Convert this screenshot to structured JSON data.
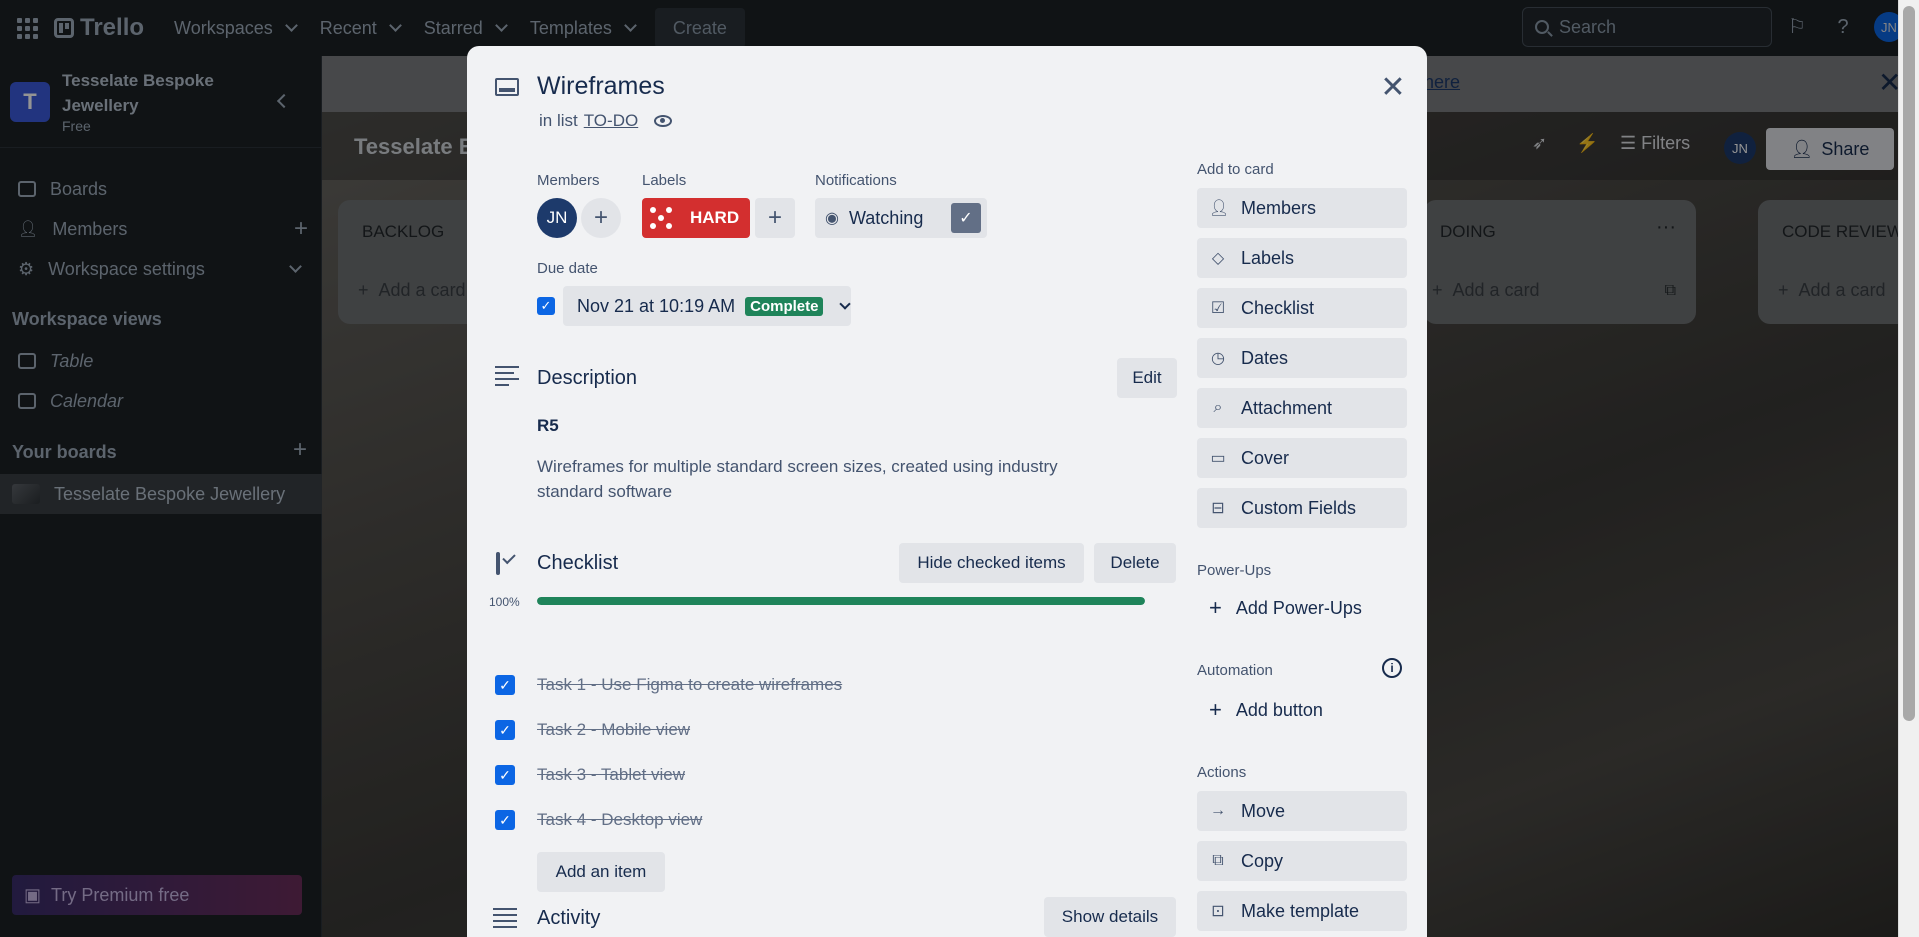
{
  "topbar": {
    "brand": "Trello",
    "nav": [
      "Workspaces",
      "Recent",
      "Starred",
      "Templates"
    ],
    "create_label": "Create",
    "search_placeholder": "Search",
    "avatar": "JN"
  },
  "sidebar": {
    "workspace_initial": "T",
    "workspace_name": "Tesselate Bespoke Jewellery",
    "workspace_plan": "Free",
    "items": [
      {
        "label": "Boards"
      },
      {
        "label": "Members"
      },
      {
        "label": "Workspace settings"
      }
    ],
    "views_heading": "Workspace views",
    "views": [
      {
        "label": "Table"
      },
      {
        "label": "Calendar"
      }
    ],
    "boards_heading": "Your boards",
    "board_name": "Tesselate Bespoke Jewellery",
    "premium_label": "Try Premium free"
  },
  "board": {
    "title": "Tesselate Bespoke Jewellery",
    "banner_link": "here",
    "filters_label": "Filters",
    "share_label": "Share",
    "avatar": "JN",
    "lists": [
      {
        "title": "BACKLOG",
        "add": "Add a card"
      },
      {
        "title": "DOING",
        "add": "Add a card"
      },
      {
        "title": "CODE REVIEW",
        "add": "Add a card"
      }
    ]
  },
  "card": {
    "title": "Wireframes",
    "in_list_prefix": "in list",
    "list_name": "TO-DO",
    "members_label": "Members",
    "member_initials": "JN",
    "labels_label": "Labels",
    "label_text": "HARD",
    "notifications_label": "Notifications",
    "watching_label": "Watching",
    "due_label": "Due date",
    "due_value": "Nov 21 at 10:19 AM",
    "due_status": "Complete",
    "description_heading": "Description",
    "edit_label": "Edit",
    "description_title": "R5",
    "description_body": "Wireframes for multiple standard screen sizes, created using industry standard software",
    "checklist_heading": "Checklist",
    "hide_checked_label": "Hide checked items",
    "delete_label": "Delete",
    "progress_text": "100%",
    "progress_fraction": 1.0,
    "checklist_items": [
      {
        "text": "Task 1 - Use Figma to create wireframes",
        "checked": true
      },
      {
        "text": "Task 2 - Mobile view",
        "checked": true
      },
      {
        "text": "Task 3 - Tablet view",
        "checked": true
      },
      {
        "text": "Task 4 - Desktop view",
        "checked": true
      }
    ],
    "add_item_label": "Add an item",
    "activity_heading": "Activity",
    "show_details_label": "Show details"
  },
  "right_panel": {
    "add_to_card_heading": "Add to card",
    "add_to_card": [
      "Members",
      "Labels",
      "Checklist",
      "Dates",
      "Attachment",
      "Cover",
      "Custom Fields"
    ],
    "powerups_heading": "Power-Ups",
    "add_powerups_label": "Add Power-Ups",
    "automation_heading": "Automation",
    "add_button_label": "Add button",
    "actions_heading": "Actions",
    "actions": [
      "Move",
      "Copy",
      "Make template"
    ]
  },
  "colors": {
    "label_red": "#d32f2f",
    "complete_green": "#1f845a",
    "checkbox_blue": "#0c66e4"
  }
}
